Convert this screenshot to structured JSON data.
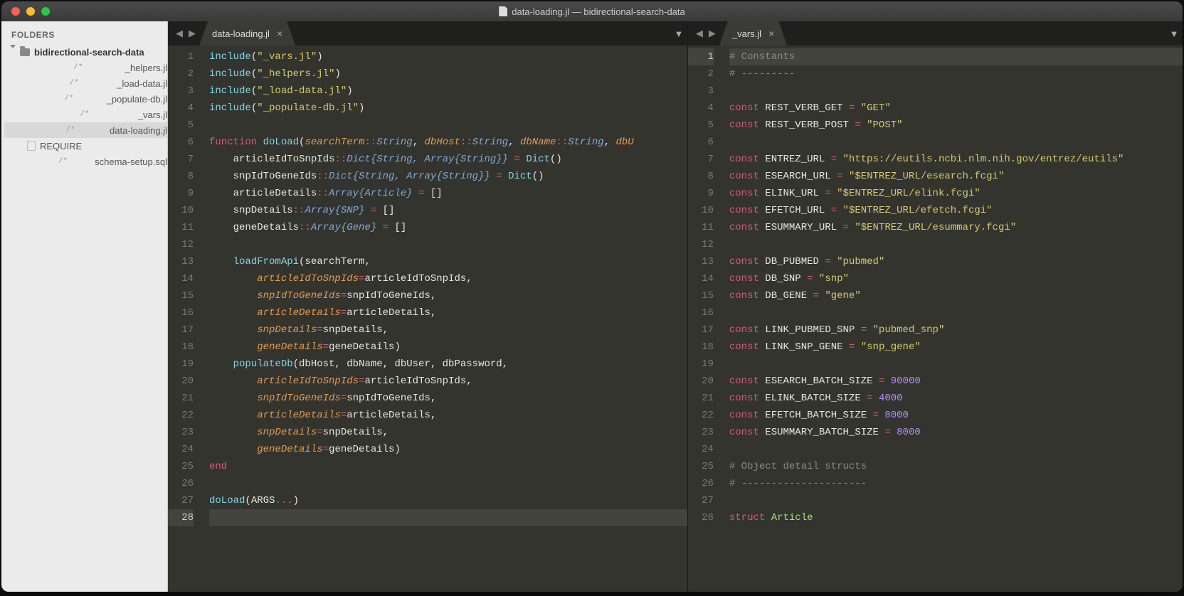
{
  "window_title": "data-loading.jl — bidirectional-search-data",
  "sidebar": {
    "header": "FOLDERS",
    "project": "bidirectional-search-data",
    "files": [
      {
        "label": "_helpers.jl",
        "kind": "code"
      },
      {
        "label": "_load-data.jl",
        "kind": "code"
      },
      {
        "label": "_populate-db.jl",
        "kind": "code"
      },
      {
        "label": "_vars.jl",
        "kind": "code"
      },
      {
        "label": "data-loading.jl",
        "kind": "code",
        "selected": true
      },
      {
        "label": "REQUIRE",
        "kind": "plain"
      },
      {
        "label": "schema-setup.sql",
        "kind": "code"
      }
    ]
  },
  "panes": {
    "left": {
      "tab": "data-loading.jl",
      "cursor_line": 28,
      "lines": [
        [
          {
            "c": "fn",
            "t": "include"
          },
          {
            "t": "("
          },
          {
            "c": "str",
            "t": "\"_vars.jl\""
          },
          {
            "t": ")"
          }
        ],
        [
          {
            "c": "fn",
            "t": "include"
          },
          {
            "t": "("
          },
          {
            "c": "str",
            "t": "\"_helpers.jl\""
          },
          {
            "t": ")"
          }
        ],
        [
          {
            "c": "fn",
            "t": "include"
          },
          {
            "t": "("
          },
          {
            "c": "str",
            "t": "\"_load-data.jl\""
          },
          {
            "t": ")"
          }
        ],
        [
          {
            "c": "fn",
            "t": "include"
          },
          {
            "t": "("
          },
          {
            "c": "str",
            "t": "\"_populate-db.jl\""
          },
          {
            "t": ")"
          }
        ],
        [],
        [
          {
            "c": "kw",
            "t": "function"
          },
          {
            "t": " "
          },
          {
            "c": "fn",
            "t": "doLoad"
          },
          {
            "t": "("
          },
          {
            "c": "param",
            "t": "searchTerm"
          },
          {
            "c": "op",
            "t": "::"
          },
          {
            "c": "type",
            "t": "String"
          },
          {
            "t": ", "
          },
          {
            "c": "param",
            "t": "dbHost"
          },
          {
            "c": "op",
            "t": "::"
          },
          {
            "c": "type",
            "t": "String"
          },
          {
            "t": ", "
          },
          {
            "c": "param",
            "t": "dbName"
          },
          {
            "c": "op",
            "t": "::"
          },
          {
            "c": "type",
            "t": "String"
          },
          {
            "t": ", "
          },
          {
            "c": "param",
            "t": "dbU"
          }
        ],
        [
          {
            "t": "    articleIdToSnpIds"
          },
          {
            "c": "op",
            "t": "::"
          },
          {
            "c": "type",
            "t": "Dict{String, Array{String}}"
          },
          {
            "t": " "
          },
          {
            "c": "op",
            "t": "="
          },
          {
            "t": " "
          },
          {
            "c": "fn",
            "t": "Dict"
          },
          {
            "t": "()"
          }
        ],
        [
          {
            "t": "    snpIdToGeneIds"
          },
          {
            "c": "op",
            "t": "::"
          },
          {
            "c": "type",
            "t": "Dict{String, Array{String}}"
          },
          {
            "t": " "
          },
          {
            "c": "op",
            "t": "="
          },
          {
            "t": " "
          },
          {
            "c": "fn",
            "t": "Dict"
          },
          {
            "t": "()"
          }
        ],
        [
          {
            "t": "    articleDetails"
          },
          {
            "c": "op",
            "t": "::"
          },
          {
            "c": "type",
            "t": "Array{Article}"
          },
          {
            "t": " "
          },
          {
            "c": "op",
            "t": "="
          },
          {
            "t": " []"
          }
        ],
        [
          {
            "t": "    snpDetails"
          },
          {
            "c": "op",
            "t": "::"
          },
          {
            "c": "type",
            "t": "Array{SNP}"
          },
          {
            "t": " "
          },
          {
            "c": "op",
            "t": "="
          },
          {
            "t": " []"
          }
        ],
        [
          {
            "t": "    geneDetails"
          },
          {
            "c": "op",
            "t": "::"
          },
          {
            "c": "type",
            "t": "Array{Gene}"
          },
          {
            "t": " "
          },
          {
            "c": "op",
            "t": "="
          },
          {
            "t": " []"
          }
        ],
        [],
        [
          {
            "t": "    "
          },
          {
            "c": "fn",
            "t": "loadFromApi"
          },
          {
            "t": "(searchTerm,"
          }
        ],
        [
          {
            "t": "        "
          },
          {
            "c": "param",
            "t": "articleIdToSnpIds"
          },
          {
            "c": "op",
            "t": "="
          },
          {
            "t": "articleIdToSnpIds,"
          }
        ],
        [
          {
            "t": "        "
          },
          {
            "c": "param",
            "t": "snpIdToGeneIds"
          },
          {
            "c": "op",
            "t": "="
          },
          {
            "t": "snpIdToGeneIds,"
          }
        ],
        [
          {
            "t": "        "
          },
          {
            "c": "param",
            "t": "articleDetails"
          },
          {
            "c": "op",
            "t": "="
          },
          {
            "t": "articleDetails,"
          }
        ],
        [
          {
            "t": "        "
          },
          {
            "c": "param",
            "t": "snpDetails"
          },
          {
            "c": "op",
            "t": "="
          },
          {
            "t": "snpDetails,"
          }
        ],
        [
          {
            "t": "        "
          },
          {
            "c": "param",
            "t": "geneDetails"
          },
          {
            "c": "op",
            "t": "="
          },
          {
            "t": "geneDetails)"
          }
        ],
        [
          {
            "t": "    "
          },
          {
            "c": "fn",
            "t": "populateDb"
          },
          {
            "t": "(dbHost, dbName, dbUser, dbPassword,"
          }
        ],
        [
          {
            "t": "        "
          },
          {
            "c": "param",
            "t": "articleIdToSnpIds"
          },
          {
            "c": "op",
            "t": "="
          },
          {
            "t": "articleIdToSnpIds,"
          }
        ],
        [
          {
            "t": "        "
          },
          {
            "c": "param",
            "t": "snpIdToGeneIds"
          },
          {
            "c": "op",
            "t": "="
          },
          {
            "t": "snpIdToGeneIds,"
          }
        ],
        [
          {
            "t": "        "
          },
          {
            "c": "param",
            "t": "articleDetails"
          },
          {
            "c": "op",
            "t": "="
          },
          {
            "t": "articleDetails,"
          }
        ],
        [
          {
            "t": "        "
          },
          {
            "c": "param",
            "t": "snpDetails"
          },
          {
            "c": "op",
            "t": "="
          },
          {
            "t": "snpDetails,"
          }
        ],
        [
          {
            "t": "        "
          },
          {
            "c": "param",
            "t": "geneDetails"
          },
          {
            "c": "op",
            "t": "="
          },
          {
            "t": "geneDetails)"
          }
        ],
        [
          {
            "c": "kw",
            "t": "end"
          }
        ],
        [],
        [
          {
            "c": "fn",
            "t": "doLoad"
          },
          {
            "t": "(ARGS"
          },
          {
            "c": "op",
            "t": "..."
          },
          {
            "t": ")"
          }
        ],
        []
      ]
    },
    "right": {
      "tab": "_vars.jl",
      "cursor_line": 1,
      "lines": [
        [
          {
            "c": "cmt",
            "t": "# Constants"
          }
        ],
        [
          {
            "c": "cmt",
            "t": "# ---------"
          }
        ],
        [],
        [
          {
            "c": "kw",
            "t": "const"
          },
          {
            "t": " REST_VERB_GET "
          },
          {
            "c": "op",
            "t": "="
          },
          {
            "t": " "
          },
          {
            "c": "str",
            "t": "\"GET\""
          }
        ],
        [
          {
            "c": "kw",
            "t": "const"
          },
          {
            "t": " REST_VERB_POST "
          },
          {
            "c": "op",
            "t": "="
          },
          {
            "t": " "
          },
          {
            "c": "str",
            "t": "\"POST\""
          }
        ],
        [],
        [
          {
            "c": "kw",
            "t": "const"
          },
          {
            "t": " ENTREZ_URL "
          },
          {
            "c": "op",
            "t": "="
          },
          {
            "t": " "
          },
          {
            "c": "str",
            "t": "\"https://eutils.ncbi.nlm.nih.gov/entrez/eutils\""
          }
        ],
        [
          {
            "c": "kw",
            "t": "const"
          },
          {
            "t": " ESEARCH_URL "
          },
          {
            "c": "op",
            "t": "="
          },
          {
            "t": " "
          },
          {
            "c": "str",
            "t": "\"$ENTREZ_URL/esearch.fcgi\""
          }
        ],
        [
          {
            "c": "kw",
            "t": "const"
          },
          {
            "t": " ELINK_URL "
          },
          {
            "c": "op",
            "t": "="
          },
          {
            "t": " "
          },
          {
            "c": "str",
            "t": "\"$ENTREZ_URL/elink.fcgi\""
          }
        ],
        [
          {
            "c": "kw",
            "t": "const"
          },
          {
            "t": " EFETCH_URL "
          },
          {
            "c": "op",
            "t": "="
          },
          {
            "t": " "
          },
          {
            "c": "str",
            "t": "\"$ENTREZ_URL/efetch.fcgi\""
          }
        ],
        [
          {
            "c": "kw",
            "t": "const"
          },
          {
            "t": " ESUMMARY_URL "
          },
          {
            "c": "op",
            "t": "="
          },
          {
            "t": " "
          },
          {
            "c": "str",
            "t": "\"$ENTREZ_URL/esummary.fcgi\""
          }
        ],
        [],
        [
          {
            "c": "kw",
            "t": "const"
          },
          {
            "t": " DB_PUBMED "
          },
          {
            "c": "op",
            "t": "="
          },
          {
            "t": " "
          },
          {
            "c": "str",
            "t": "\"pubmed\""
          }
        ],
        [
          {
            "c": "kw",
            "t": "const"
          },
          {
            "t": " DB_SNP "
          },
          {
            "c": "op",
            "t": "="
          },
          {
            "t": " "
          },
          {
            "c": "str",
            "t": "\"snp\""
          }
        ],
        [
          {
            "c": "kw",
            "t": "const"
          },
          {
            "t": " DB_GENE "
          },
          {
            "c": "op",
            "t": "="
          },
          {
            "t": " "
          },
          {
            "c": "str",
            "t": "\"gene\""
          }
        ],
        [],
        [
          {
            "c": "kw",
            "t": "const"
          },
          {
            "t": " LINK_PUBMED_SNP "
          },
          {
            "c": "op",
            "t": "="
          },
          {
            "t": " "
          },
          {
            "c": "str",
            "t": "\"pubmed_snp\""
          }
        ],
        [
          {
            "c": "kw",
            "t": "const"
          },
          {
            "t": " LINK_SNP_GENE "
          },
          {
            "c": "op",
            "t": "="
          },
          {
            "t": " "
          },
          {
            "c": "str",
            "t": "\"snp_gene\""
          }
        ],
        [],
        [
          {
            "c": "kw",
            "t": "const"
          },
          {
            "t": " ESEARCH_BATCH_SIZE "
          },
          {
            "c": "op",
            "t": "="
          },
          {
            "t": " "
          },
          {
            "c": "num",
            "t": "90000"
          }
        ],
        [
          {
            "c": "kw",
            "t": "const"
          },
          {
            "t": " ELINK_BATCH_SIZE "
          },
          {
            "c": "op",
            "t": "="
          },
          {
            "t": " "
          },
          {
            "c": "num",
            "t": "4000"
          }
        ],
        [
          {
            "c": "kw",
            "t": "const"
          },
          {
            "t": " EFETCH_BATCH_SIZE "
          },
          {
            "c": "op",
            "t": "="
          },
          {
            "t": " "
          },
          {
            "c": "num",
            "t": "8000"
          }
        ],
        [
          {
            "c": "kw",
            "t": "const"
          },
          {
            "t": " ESUMMARY_BATCH_SIZE "
          },
          {
            "c": "op",
            "t": "="
          },
          {
            "t": " "
          },
          {
            "c": "num",
            "t": "8000"
          }
        ],
        [],
        [
          {
            "c": "cmt",
            "t": "# Object detail structs"
          }
        ],
        [
          {
            "c": "cmt",
            "t": "# ---------------------"
          }
        ],
        [],
        [
          {
            "c": "kw",
            "t": "struct"
          },
          {
            "t": " "
          },
          {
            "c": "struct",
            "t": "Article"
          }
        ]
      ]
    }
  }
}
